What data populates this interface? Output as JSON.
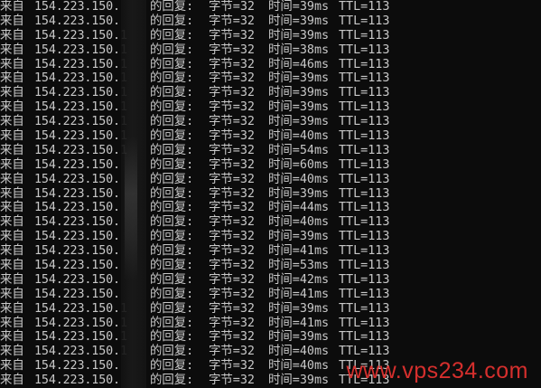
{
  "console": {
    "lines": [
      {
        "prefix": "来自",
        "ip": "154.223.150.",
        "reply": "的回复:",
        "bytes": "字节=32",
        "time": "时间=39ms",
        "ttl": "TTL=113"
      },
      {
        "prefix": "来自",
        "ip": "154.223.150.",
        "reply": "的回复:",
        "bytes": "字节=32",
        "time": "时间=39ms",
        "ttl": "TTL=113"
      },
      {
        "prefix": "来自",
        "ip": "154.223.150.1",
        "reply": "的回复:",
        "bytes": "字节=32",
        "time": "时间=39ms",
        "ttl": "TTL=113"
      },
      {
        "prefix": "来自",
        "ip": "154.223.150.1",
        "reply": "的回复:",
        "bytes": "字节=32",
        "time": "时间=38ms",
        "ttl": "TTL=113"
      },
      {
        "prefix": "来自",
        "ip": "154.223.150.1",
        "reply": "的回复:",
        "bytes": "字节=32",
        "time": "时间=46ms",
        "ttl": "TTL=113"
      },
      {
        "prefix": "来自",
        "ip": "154.223.150.1",
        "reply": "的回复:",
        "bytes": "字节=32",
        "time": "时间=39ms",
        "ttl": "TTL=113"
      },
      {
        "prefix": "来自",
        "ip": "154.223.150.1",
        "reply": "的回复:",
        "bytes": "字节=32",
        "time": "时间=39ms",
        "ttl": "TTL=113"
      },
      {
        "prefix": "来自",
        "ip": "154.223.150.1",
        "reply": "的回复:",
        "bytes": "字节=32",
        "time": "时间=39ms",
        "ttl": "TTL=113"
      },
      {
        "prefix": "来自",
        "ip": "154.223.150.1",
        "reply": "的回复:",
        "bytes": "字节=32",
        "time": "时间=39ms",
        "ttl": "TTL=113"
      },
      {
        "prefix": "来自",
        "ip": "154.223.150.1",
        "reply": "的回复:",
        "bytes": "字节=32",
        "time": "时间=40ms",
        "ttl": "TTL=113"
      },
      {
        "prefix": "来自",
        "ip": "154.223.150.1",
        "reply": "的回复:",
        "bytes": "字节=32",
        "time": "时间=54ms",
        "ttl": "TTL=113"
      },
      {
        "prefix": "来自",
        "ip": "154.223.150.",
        "reply": "的回复:",
        "bytes": "字节=32",
        "time": "时间=60ms",
        "ttl": "TTL=113"
      },
      {
        "prefix": "来自",
        "ip": "154.223.150.",
        "reply": "的回复:",
        "bytes": "字节=32",
        "time": "时间=40ms",
        "ttl": "TTL=113"
      },
      {
        "prefix": "来自",
        "ip": "154.223.150.",
        "reply": "的回复:",
        "bytes": "字节=32",
        "time": "时间=39ms",
        "ttl": "TTL=113"
      },
      {
        "prefix": "来自",
        "ip": "154.223.150.",
        "reply": "的回复:",
        "bytes": "字节=32",
        "time": "时间=44ms",
        "ttl": "TTL=113"
      },
      {
        "prefix": "来自",
        "ip": "154.223.150.",
        "reply": "的回复:",
        "bytes": "字节=32",
        "time": "时间=40ms",
        "ttl": "TTL=113"
      },
      {
        "prefix": "来自",
        "ip": "154.223.150.",
        "reply": "的回复:",
        "bytes": "字节=32",
        "time": "时间=39ms",
        "ttl": "TTL=113"
      },
      {
        "prefix": "来自",
        "ip": "154.223.150.",
        "reply": "的回复:",
        "bytes": "字节=32",
        "time": "时间=41ms",
        "ttl": "TTL=113"
      },
      {
        "prefix": "来自",
        "ip": "154.223.150.",
        "reply": "的回复:",
        "bytes": "字节=32",
        "time": "时间=53ms",
        "ttl": "TTL=113"
      },
      {
        "prefix": "来自",
        "ip": "154.223.150.",
        "reply": "的回复:",
        "bytes": "字节=32",
        "time": "时间=42ms",
        "ttl": "TTL=113"
      },
      {
        "prefix": "来自",
        "ip": "154.223.150.",
        "reply": "的回复:",
        "bytes": "字节=32",
        "time": "时间=41ms",
        "ttl": "TTL=113"
      },
      {
        "prefix": "来自",
        "ip": "154.223.150.1",
        "reply": "的回复:",
        "bytes": "字节=32",
        "time": "时间=39ms",
        "ttl": "TTL=113"
      },
      {
        "prefix": "来自",
        "ip": "154.223.150.1",
        "reply": "的回复:",
        "bytes": "字节=32",
        "time": "时间=41ms",
        "ttl": "TTL=113"
      },
      {
        "prefix": "来自",
        "ip": "154.223.150.1",
        "reply": "的回复:",
        "bytes": "字节=32",
        "time": "时间=39ms",
        "ttl": "TTL=113"
      },
      {
        "prefix": "来自",
        "ip": "154.223.150.1",
        "reply": "的回复:",
        "bytes": "字节=32",
        "time": "时间=40ms",
        "ttl": "TTL=113"
      },
      {
        "prefix": "来自",
        "ip": "154.223.150.",
        "reply": "的回复:",
        "bytes": "字节=32",
        "time": "时间=40ms",
        "ttl": "TTL=113"
      },
      {
        "prefix": "来自",
        "ip": "154.223.150.",
        "reply": "的回复:",
        "bytes": "字节=32",
        "time": "时间=39ms",
        "ttl": "TTL=113"
      }
    ]
  },
  "watermark": {
    "text": "www.vps234.com",
    "color": "#e0312f"
  },
  "colors": {
    "background": "#0c0c0c",
    "text": "#c8c8c8"
  }
}
